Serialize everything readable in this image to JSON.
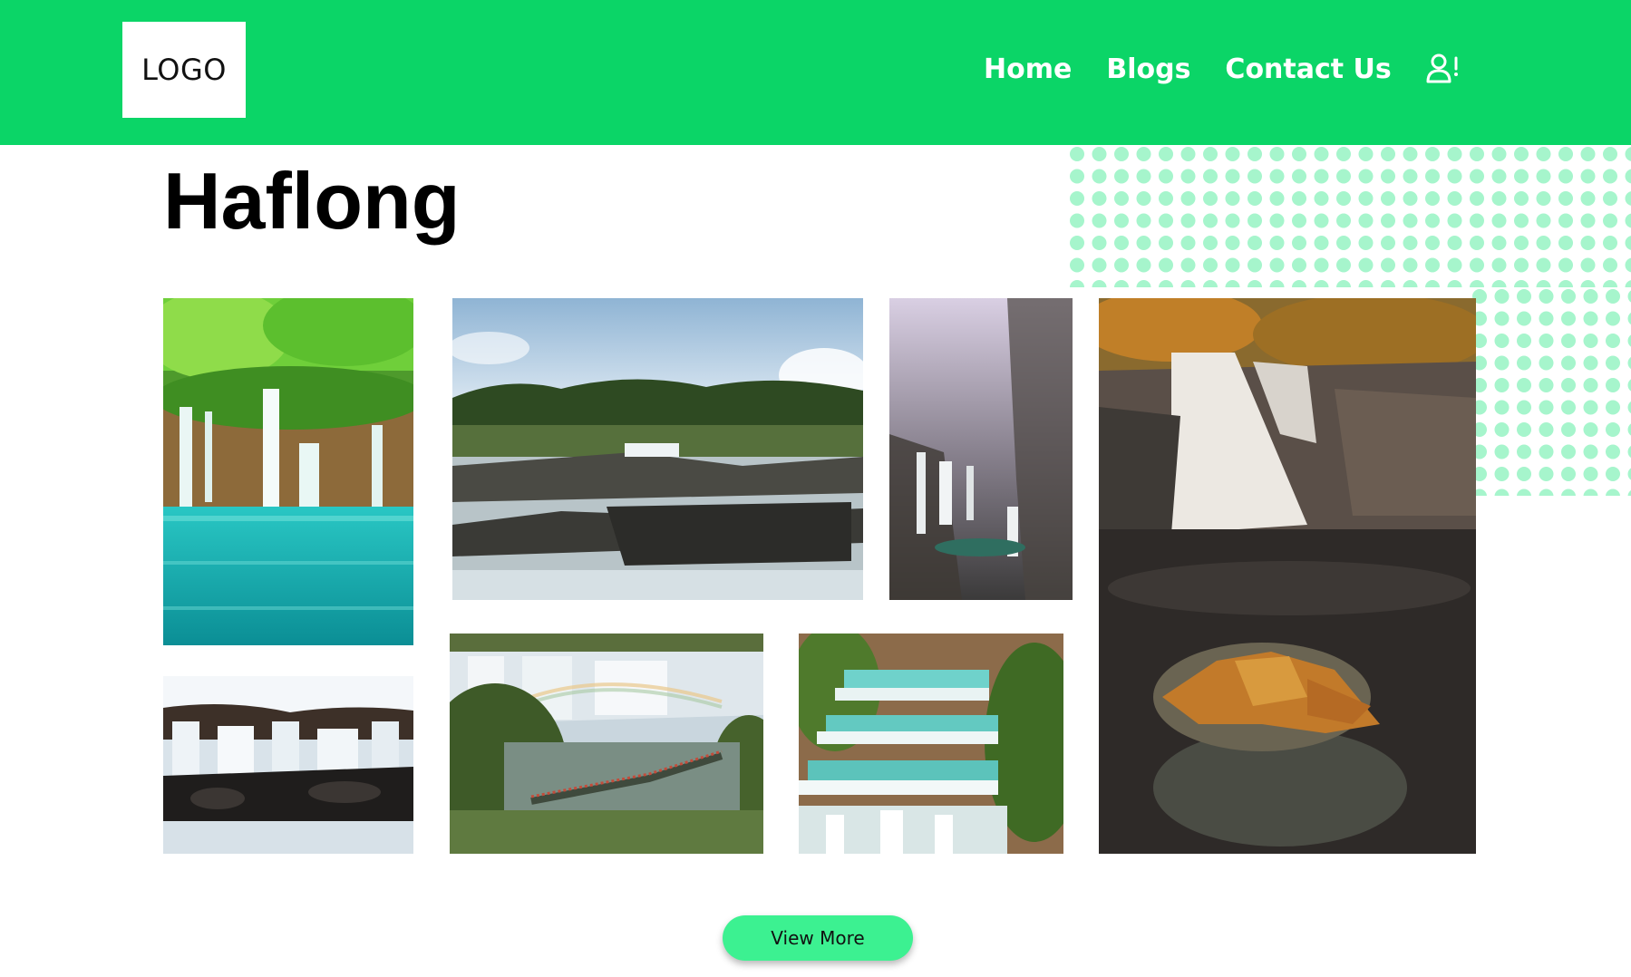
{
  "header": {
    "logo_text": "LOGO",
    "nav": [
      {
        "label": "Home"
      },
      {
        "label": "Blogs"
      },
      {
        "label": "Contact Us"
      }
    ],
    "user_icon": "user-alert-icon"
  },
  "page": {
    "title": "Haflong"
  },
  "gallery": {
    "images": [
      {
        "name": "turquoise-lagoon-waterfall"
      },
      {
        "name": "rocky-river-rapids"
      },
      {
        "name": "misty-gorge-waterfall"
      },
      {
        "name": "autumn-forest-waterfall"
      },
      {
        "name": "wide-cascade-falls"
      },
      {
        "name": "iguazu-falls-walkway"
      },
      {
        "name": "tiered-turquoise-cascades"
      }
    ]
  },
  "actions": {
    "view_more_label": "View More"
  },
  "colors": {
    "brand_green": "#0bd567",
    "button_green": "#3cf191",
    "dot_green": "#a6f5cc"
  }
}
